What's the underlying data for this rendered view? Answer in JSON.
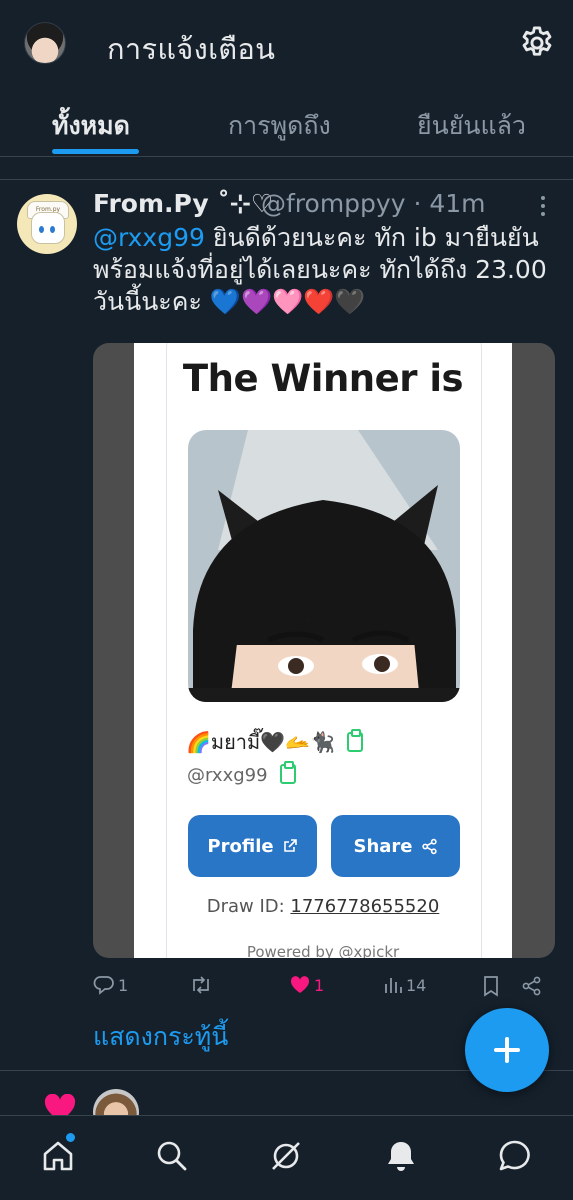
{
  "header": {
    "title": "การแจ้งเตือน"
  },
  "tabs": [
    {
      "label": "ทั้งหมด",
      "active": true
    },
    {
      "label": "การพูดถึง",
      "active": false
    },
    {
      "label": "ยืนยันแล้ว",
      "active": false
    }
  ],
  "post": {
    "display_name": "From.Py ˚⊹♡",
    "handle_time": "@fromppyy · 41m",
    "mention": "@rxxg99",
    "text": " ยินดีด้วยนะคะ ทัก ib มายืนยันพร้อมแจ้งที่อยู่ได้เลยนะคะ ทักได้ถึง 23.00 วันนี้นะคะ 💙💜🩷❤️🖤",
    "avatar_label": "From.py",
    "card": {
      "heading": "The Winner is",
      "nickname": "🌈มยามี๊🖤🫴🐈‍⬛",
      "username": "@rxxg99",
      "profile_button": "Profile",
      "share_button": "Share",
      "draw_id_label": "Draw ID: ",
      "draw_id_value": "1776778655520",
      "powered_by": "Powered by @xpickr"
    },
    "stats": {
      "replies": "1",
      "retweets": "",
      "likes": "1",
      "views": "14"
    },
    "show_more": "แสดงกระทู้นี้"
  },
  "colors": {
    "background": "#15202b",
    "accent": "#1d9bf0",
    "like": "#f91880",
    "muted": "#8b98a5",
    "card_button": "#2a76c6"
  },
  "icons": {
    "settings": "gear-icon",
    "reply": "reply-icon",
    "retweet": "retweet-icon",
    "like": "heart-icon",
    "views": "views-icon",
    "bookmark": "bookmark-icon",
    "share": "share-icon",
    "compose": "plus-icon",
    "nav": [
      "home-icon",
      "search-icon",
      "grok-icon",
      "bell-icon",
      "messages-icon"
    ]
  }
}
